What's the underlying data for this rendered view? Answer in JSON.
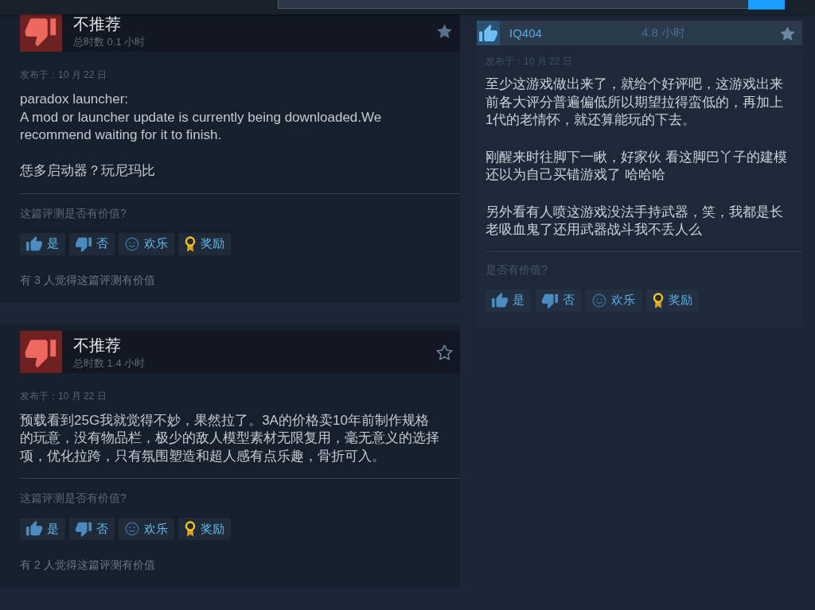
{
  "left_column": {
    "reviews": [
      {
        "kind": "verdict",
        "recommended": false,
        "title": "不推荐",
        "playtime": "总时数 0.1 小时",
        "starred": true,
        "date": "发布于：10 月 22 日",
        "paragraphs": [
          "paradox launcher:\nA mod or launcher update is currently being downloaded.We recommend waiting for it to finish.",
          "恁多启动器？玩尼玛比"
        ],
        "helpful_prompt": "这篇评测是否有价值?",
        "buttons": [
          {
            "kind": "yes",
            "label": "是"
          },
          {
            "kind": "no",
            "label": "否"
          },
          {
            "kind": "funny",
            "label": "欢乐"
          },
          {
            "kind": "award",
            "label": "奖励"
          }
        ],
        "helpful_count": "有 3 人觉得这篇评测有价值"
      },
      {
        "kind": "verdict",
        "recommended": false,
        "title": "不推荐",
        "playtime": "总时数 1.4 小时",
        "starred": false,
        "date": "发布于：10 月 22 日",
        "paragraphs": [
          "预载看到25G我就觉得不妙，果然拉了。3A的价格卖10年前制作规格的玩意，没有物品栏，极少的敌人模型素材无限复用，毫无意义的选择项，优化拉跨，只有氛围塑造和超人感有点乐趣，骨折可入。"
        ],
        "helpful_prompt": "这篇评测是否有价值?",
        "buttons": [
          {
            "kind": "yes",
            "label": "是"
          },
          {
            "kind": "no",
            "label": "否"
          },
          {
            "kind": "funny",
            "label": "欢乐"
          },
          {
            "kind": "award",
            "label": "奖励"
          }
        ],
        "helpful_count": "有 2 人觉得这篇评测有价值"
      }
    ]
  },
  "right_column": {
    "reviews": [
      {
        "kind": "author",
        "recommended": true,
        "author": "IQ404",
        "hours": "4.8 小时",
        "starred": true,
        "date": "发布于：10 月 22 日",
        "paragraphs": [
          "至少这游戏做出来了，就给个好评吧，这游戏出来前各大评分普遍偏低所以期望拉得蛮低的，再加上1代的老情怀，就还算能玩的下去。",
          "刚醒来时往脚下一瞅，好家伙 看这脚巴丫子的建模还以为自己买错游戏了 哈哈哈",
          "另外看有人喷这游戏没法手持武器，笑，我都是长老吸血鬼了还用武器战斗我不丢人么"
        ],
        "helpful_prompt": "是否有价值?",
        "buttons": [
          {
            "kind": "yes",
            "label": "是"
          },
          {
            "kind": "no",
            "label": "否"
          },
          {
            "kind": "funny",
            "label": "欢乐"
          },
          {
            "kind": "award",
            "label": "奖励"
          }
        ]
      }
    ]
  }
}
